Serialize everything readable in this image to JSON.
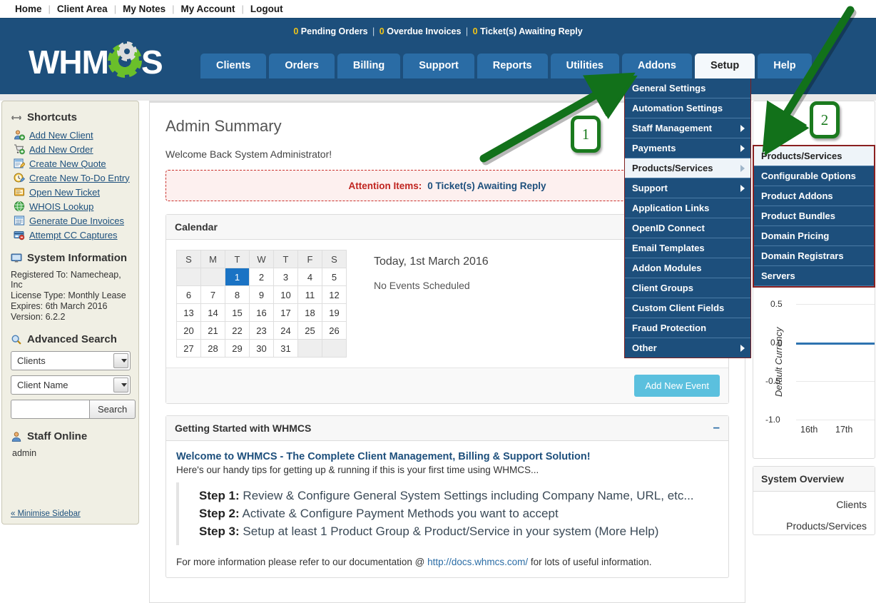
{
  "topbar": {
    "links": [
      "Home",
      "Client Area",
      "My Notes",
      "My Account",
      "Logout"
    ]
  },
  "header": {
    "logo_text_1": "WHM",
    "logo_text_2": "S",
    "status": {
      "pending_orders_count": "0",
      "pending_orders_label": "Pending Orders",
      "overdue_invoices_count": "0",
      "overdue_invoices_label": "Overdue Invoices",
      "tickets_count": "0",
      "tickets_label": "Ticket(s) Awaiting Reply",
      "separator": "|"
    },
    "tabs": [
      {
        "label": "Clients",
        "active": false
      },
      {
        "label": "Orders",
        "active": false
      },
      {
        "label": "Billing",
        "active": false
      },
      {
        "label": "Support",
        "active": false
      },
      {
        "label": "Reports",
        "active": false
      },
      {
        "label": "Utilities",
        "active": false
      },
      {
        "label": "Addons",
        "active": false
      },
      {
        "label": "Setup",
        "active": true
      },
      {
        "label": "Help",
        "active": false
      }
    ]
  },
  "setup_menu": {
    "items": [
      {
        "label": "General Settings",
        "submenu": false,
        "highlighted": false
      },
      {
        "label": "Automation Settings",
        "submenu": false,
        "highlighted": false
      },
      {
        "label": "Staff Management",
        "submenu": true,
        "highlighted": false
      },
      {
        "label": "Payments",
        "submenu": true,
        "highlighted": false
      },
      {
        "label": "Products/Services",
        "submenu": true,
        "highlighted": true
      },
      {
        "label": "Support",
        "submenu": true,
        "highlighted": false
      },
      {
        "label": "Application Links",
        "submenu": false,
        "highlighted": false
      },
      {
        "label": "OpenID Connect",
        "submenu": false,
        "highlighted": false
      },
      {
        "label": "Email Templates",
        "submenu": false,
        "highlighted": false
      },
      {
        "label": "Addon Modules",
        "submenu": false,
        "highlighted": false
      },
      {
        "label": "Client Groups",
        "submenu": false,
        "highlighted": false
      },
      {
        "label": "Custom Client Fields",
        "submenu": false,
        "highlighted": false
      },
      {
        "label": "Fraud Protection",
        "submenu": false,
        "highlighted": false
      },
      {
        "label": "Other",
        "submenu": true,
        "highlighted": false
      }
    ]
  },
  "products_submenu": {
    "items": [
      {
        "label": "Products/Services",
        "highlighted": true
      },
      {
        "label": "Configurable Options",
        "highlighted": false
      },
      {
        "label": "Product Addons",
        "highlighted": false
      },
      {
        "label": "Product Bundles",
        "highlighted": false
      },
      {
        "label": "Domain Pricing",
        "highlighted": false
      },
      {
        "label": "Domain Registrars",
        "highlighted": false
      },
      {
        "label": "Servers",
        "highlighted": false
      }
    ]
  },
  "sidebar": {
    "shortcuts_title": "Shortcuts",
    "shortcuts_icon": "link-icon",
    "shortcuts": [
      {
        "label": "Add New Client",
        "icon": "add-user-icon"
      },
      {
        "label": "Add New Order",
        "icon": "cart-icon"
      },
      {
        "label": "Create New Quote",
        "icon": "quote-icon"
      },
      {
        "label": "Create New To-Do Entry",
        "icon": "todo-icon"
      },
      {
        "label": "Open New Ticket",
        "icon": "ticket-icon"
      },
      {
        "label": "WHOIS Lookup",
        "icon": "globe-icon"
      },
      {
        "label": "Generate Due Invoices",
        "icon": "invoice-icon"
      },
      {
        "label": "Attempt CC Captures",
        "icon": "creditcard-icon"
      }
    ],
    "sysinfo_title": "System Information",
    "sysinfo_icon": "monitor-icon",
    "sysinfo": [
      "Registered To: Namecheap, Inc",
      "License Type: Monthly Lease",
      "Expires: 6th March 2016",
      "Version: 6.2.2"
    ],
    "search_title": "Advanced Search",
    "search_icon": "magnifier-icon",
    "search_type_value": "Clients",
    "search_field_value": "Client Name",
    "search_input_value": "",
    "search_input_placeholder": "",
    "search_button": "Search",
    "staff_title": "Staff Online",
    "staff_icon": "user-icon",
    "staff_list": [
      "admin"
    ],
    "minimise_label": "« Minimise Sidebar"
  },
  "main": {
    "page_title": "Admin Summary",
    "welcome": "Welcome Back System Administrator!",
    "attention_label": "Attention Items:",
    "attention_value": "0 Ticket(s) Awaiting Reply",
    "calendar": {
      "title": "Calendar",
      "day_headers": [
        "S",
        "M",
        "T",
        "W",
        "T",
        "F",
        "S"
      ],
      "weeks": [
        [
          "",
          "",
          "1",
          "2",
          "3",
          "4",
          "5"
        ],
        [
          "6",
          "7",
          "8",
          "9",
          "10",
          "11",
          "12"
        ],
        [
          "13",
          "14",
          "15",
          "16",
          "17",
          "18",
          "19"
        ],
        [
          "20",
          "21",
          "22",
          "23",
          "24",
          "25",
          "26"
        ],
        [
          "27",
          "28",
          "29",
          "30",
          "31",
          "",
          ""
        ]
      ],
      "today_value": "1",
      "today_text": "Today, 1st March 2016",
      "events_text": "No Events Scheduled",
      "add_event_button": "Add New Event"
    },
    "getting_started": {
      "panel_title": "Getting Started with WHMCS",
      "collapse_icon": "minus-icon",
      "heading": "Welcome to WHMCS - The Complete Client Management, Billing & Support Solution!",
      "subheading": "Here's our handy tips for getting up & running if this is your first time using WHMCS...",
      "steps": [
        {
          "num": "Step 1:",
          "text": "Review & Configure General System Settings including Company Name, URL, etc..."
        },
        {
          "num": "Step 2:",
          "text": "Activate & Configure Payment Methods you want to accept"
        },
        {
          "num": "Step 3:",
          "text": "Setup at least 1 Product Group & Product/Service in your system (More Help)"
        }
      ],
      "footer_pre": "For more information please refer to our documentation @ ",
      "footer_link": "http://docs.whmcs.com/",
      "footer_post": " for lots of useful information."
    }
  },
  "right_column": {
    "system_overview_title": "System Overview",
    "system_overview_rows": [
      "Clients",
      "Products/Services"
    ]
  },
  "chart_data": {
    "type": "line",
    "title": "",
    "xlabel": "",
    "ylabel": "Default Currency",
    "x": [
      "16th",
      "17th"
    ],
    "series": [
      {
        "name": "Default Currency",
        "values": [
          0.0,
          0.0
        ],
        "color": "#2e73b0"
      }
    ],
    "yticks": [
      "0.5",
      "0.0",
      "-0.5",
      "-1.0"
    ],
    "ylim": [
      -1.0,
      0.5
    ],
    "grid": true,
    "legend": "none"
  },
  "annotations": {
    "badges": [
      {
        "number": "1",
        "color": "#1a7a1e"
      },
      {
        "number": "2",
        "color": "#1a7a1e"
      }
    ],
    "arrow_color": "#12711a"
  }
}
